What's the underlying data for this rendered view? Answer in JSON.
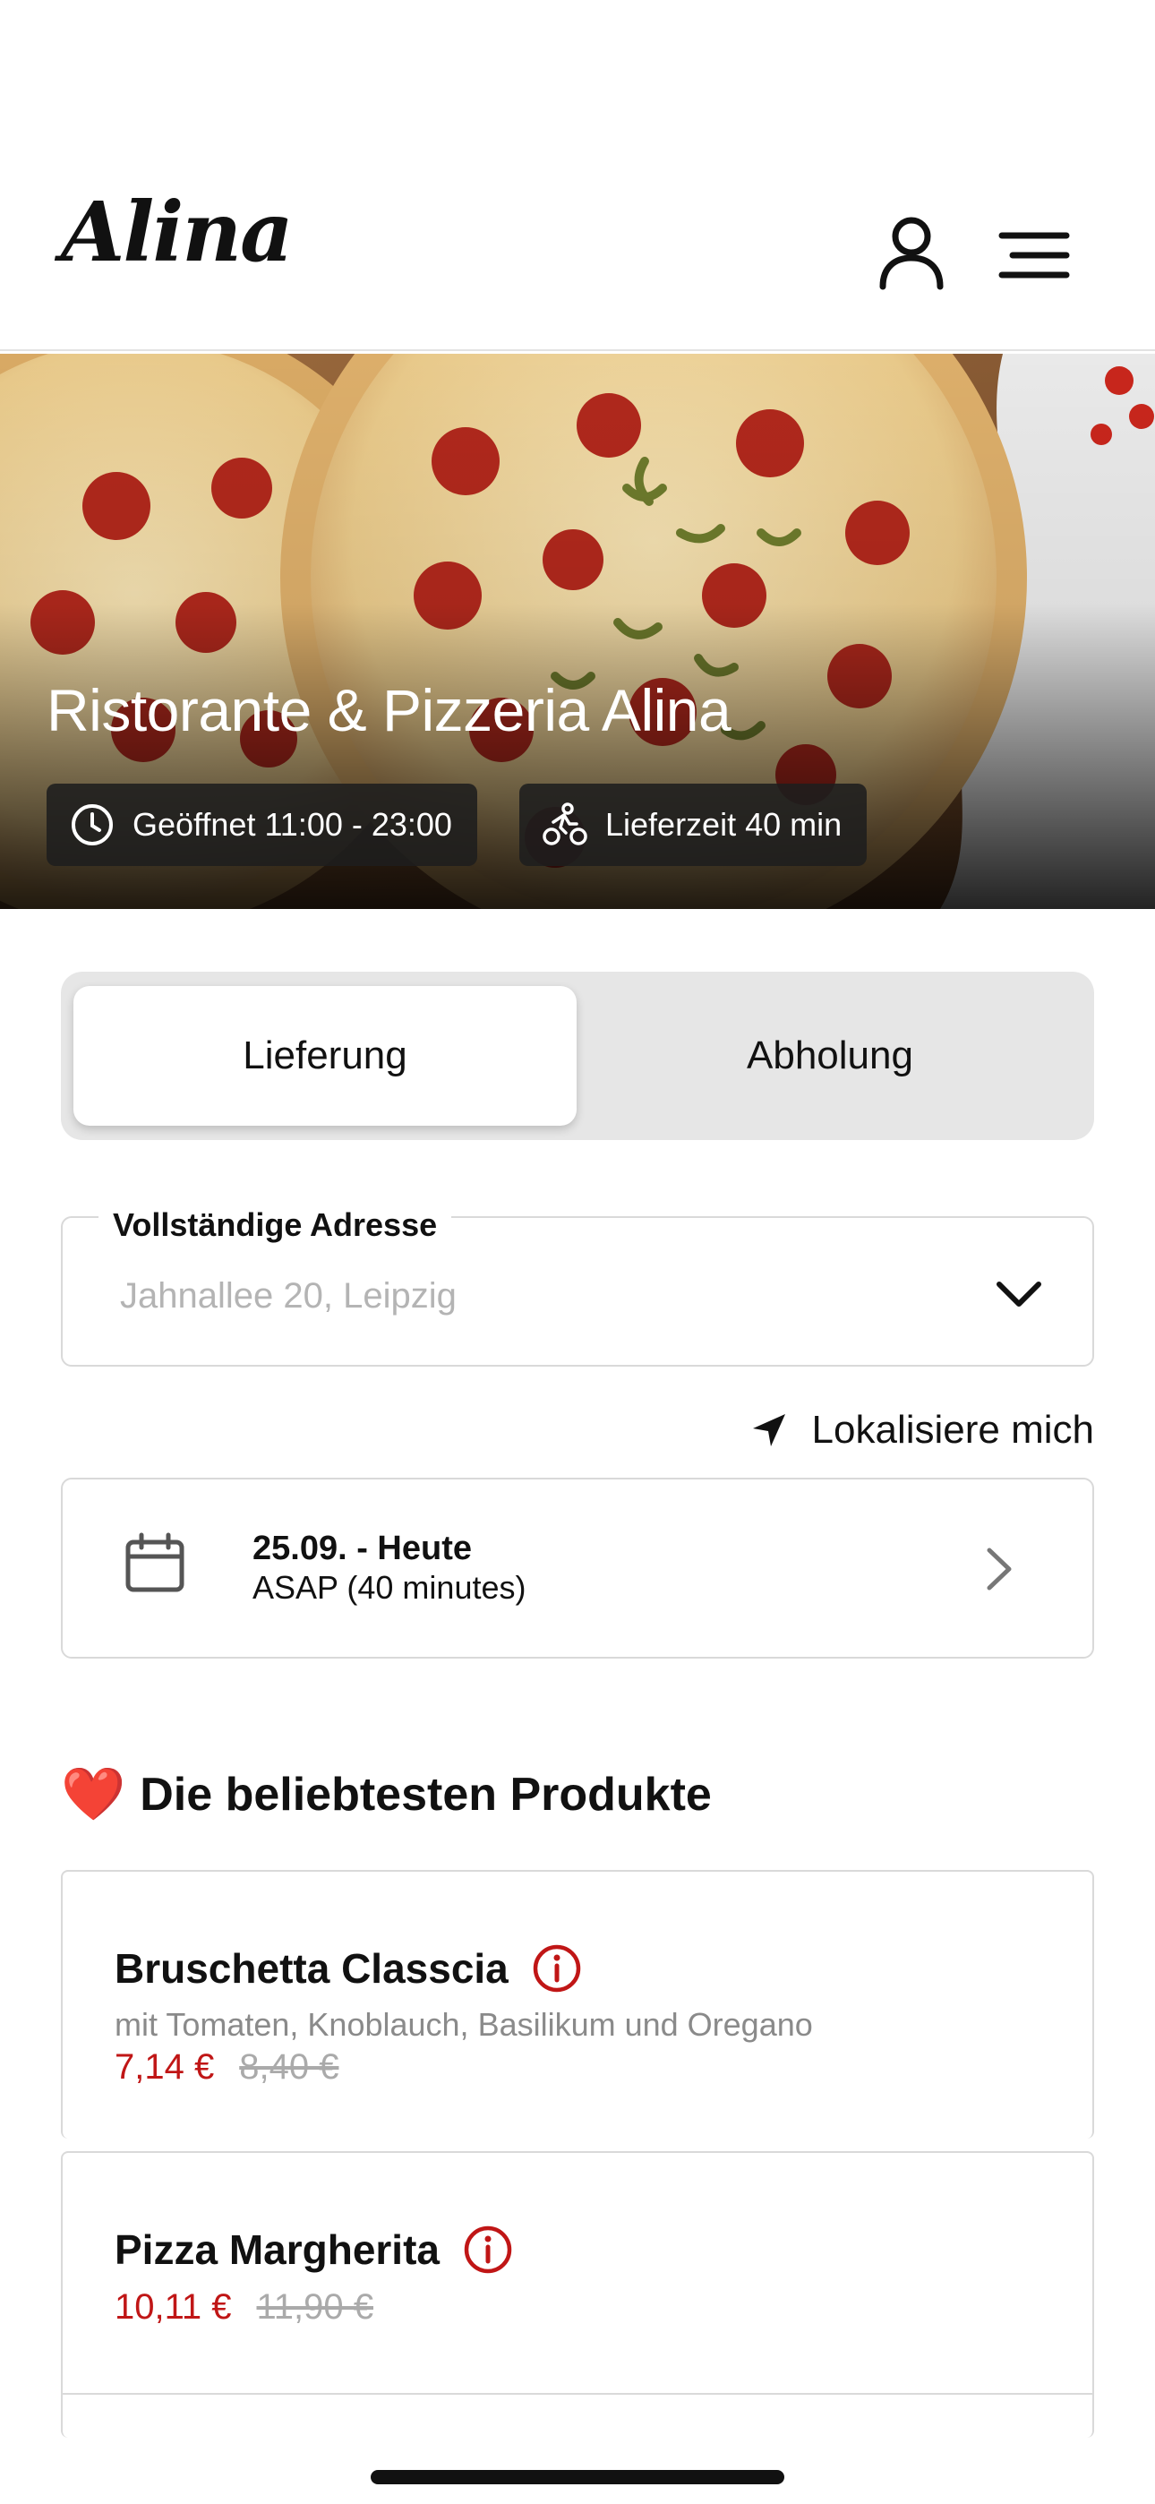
{
  "header": {
    "logo_text": "Alina",
    "user_icon": "user-icon",
    "menu_icon": "menu-icon"
  },
  "hero": {
    "title": "Ristorante & Pizzeria Alina",
    "open_hours": "Geöffnet 11:00 - 23:00",
    "delivery_time": "Lieferzeit 40 min"
  },
  "order_mode": {
    "options": [
      "Lieferung",
      "Abholung"
    ],
    "selected": "Lieferung"
  },
  "address": {
    "label": "Vollständige Adresse",
    "placeholder": "Jahnallee 20, Leipzig"
  },
  "locate": {
    "label": "Lokalisiere mich"
  },
  "schedule": {
    "date": "25.09. - Heute",
    "time": "ASAP (40 minutes)"
  },
  "popular": {
    "title": "Die beliebtesten Produkte",
    "heart": "❤️",
    "products": [
      {
        "name": "Bruschetta Classcia",
        "description": "mit Tomaten, Knoblauch, Basilikum und Oregano",
        "price": "7,14 €",
        "old_price": "8,40 €"
      },
      {
        "name": "Pizza Margherita",
        "description": "",
        "price": "10,11 €",
        "old_price": "11,90 €"
      }
    ]
  },
  "colors": {
    "price_red": "#c01616",
    "toggle_bg": "#e6e6e6",
    "chip_bg": "#1e1e1e"
  }
}
